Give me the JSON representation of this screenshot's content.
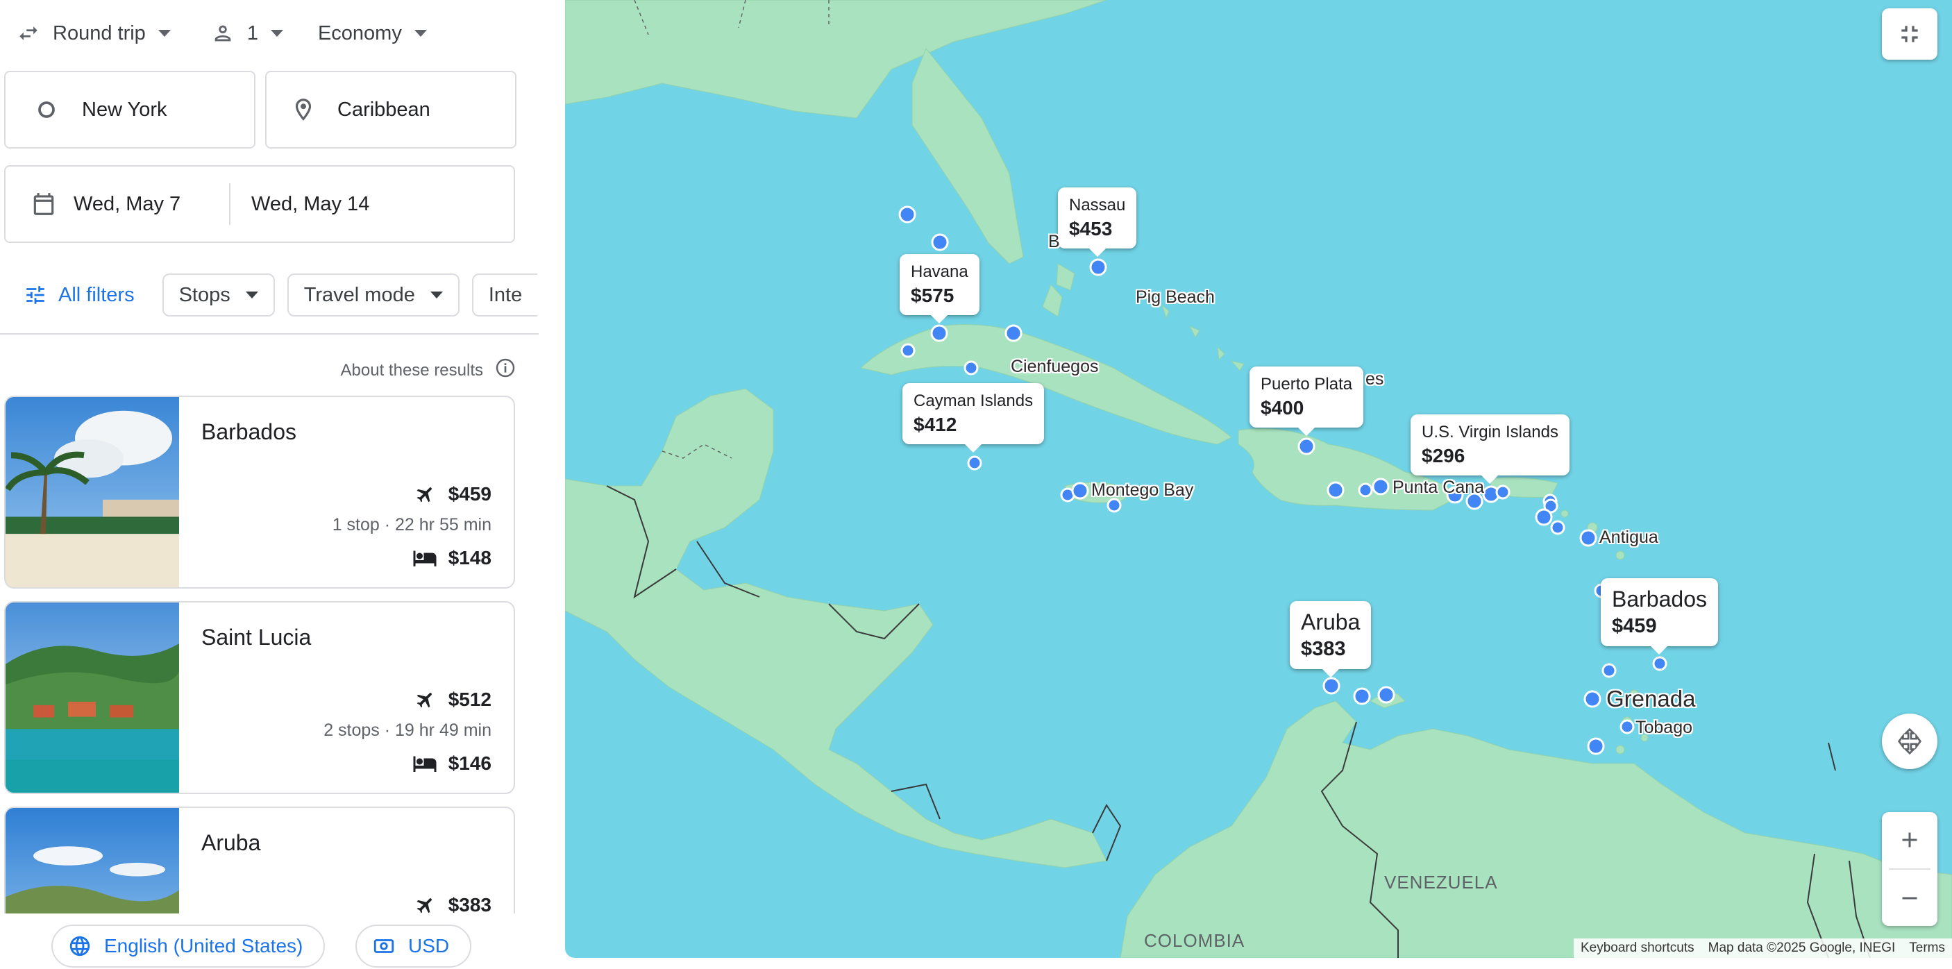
{
  "search": {
    "trip_type": "Round trip",
    "passengers": "1",
    "cabin": "Economy",
    "origin": "New York",
    "destination": "Caribbean",
    "depart_date": "Wed, May 7",
    "return_date": "Wed, May 14"
  },
  "filters": {
    "all_filters": "All filters",
    "stops": "Stops",
    "travel_mode": "Travel mode",
    "interests_partial": "Inte"
  },
  "about_results": "About these results",
  "results": [
    {
      "name": "Barbados",
      "flight_price": "$459",
      "meta": "1 stop · 22 hr 55 min",
      "hotel_price": "$148"
    },
    {
      "name": "Saint Lucia",
      "flight_price": "$512",
      "meta": "2 stops · 19 hr 49 min",
      "hotel_price": "$146"
    },
    {
      "name": "Aruba",
      "flight_price": "$383"
    }
  ],
  "footer": {
    "language": "English (United States)",
    "currency": "USD"
  },
  "map": {
    "price_pins": [
      {
        "name": "Nassau",
        "price": "$453"
      },
      {
        "name": "Havana",
        "price": "$575"
      },
      {
        "name": "Cayman Islands",
        "price": "$412"
      },
      {
        "name": "Puerto Plata",
        "price": "$400"
      },
      {
        "name": "U.S. Virgin Islands",
        "price": "$296"
      },
      {
        "name": "Aruba",
        "price": "$383"
      },
      {
        "name": "Barbados",
        "price": "$459"
      }
    ],
    "place_labels": {
      "pig_beach": "Pig Beach",
      "cienfuegos": "Cienfuegos",
      "montego_bay": "Montego Bay",
      "punta_cana": "Punta Cana",
      "antigua": "Antigua",
      "grenada": "Grenada",
      "tobago": "Tobago",
      "bimini_partial": "B",
      "turks_partial": "es"
    },
    "countries": {
      "venezuela": "VENEZUELA",
      "colombia": "COLOMBIA"
    },
    "attribution": {
      "shortcuts": "Keyboard shortcuts",
      "map_data": "Map data ©2025 Google, INEGI",
      "terms": "Terms"
    }
  },
  "colors": {
    "accent": "#1a73e8",
    "water": "#71d3e6",
    "land": "#a3e0bb",
    "pin": "#4285f4"
  }
}
